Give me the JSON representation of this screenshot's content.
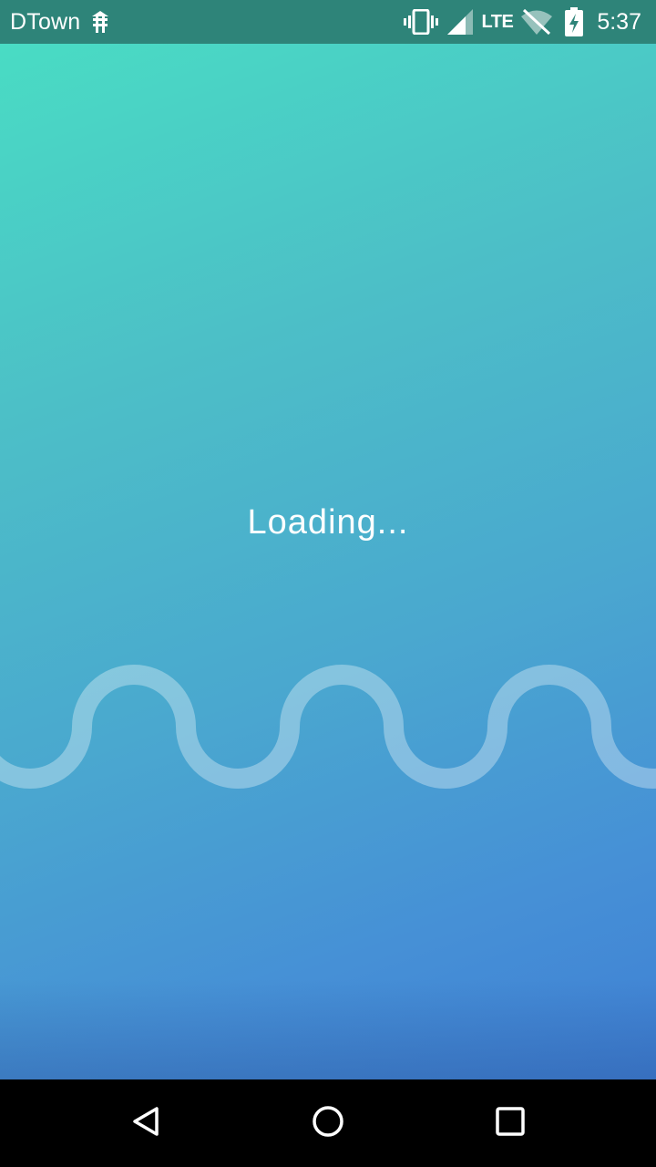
{
  "status_bar": {
    "carrier": "DTown",
    "network_type": "LTE",
    "time": "5:37"
  },
  "main": {
    "loading_text": "Loading..."
  },
  "colors": {
    "status_bar": "#2e8479",
    "gradient_top": "#49dcc4",
    "gradient_bottom": "#3f80d4",
    "nav_bar": "#000000"
  },
  "icons": {
    "carrier": "tower-icon",
    "vibrate": "vibrate-icon",
    "signal": "signal-icon",
    "wifi": "wifi-off-icon",
    "battery": "battery-charging-icon",
    "back": "back-icon",
    "home": "home-icon",
    "recents": "recents-icon"
  }
}
